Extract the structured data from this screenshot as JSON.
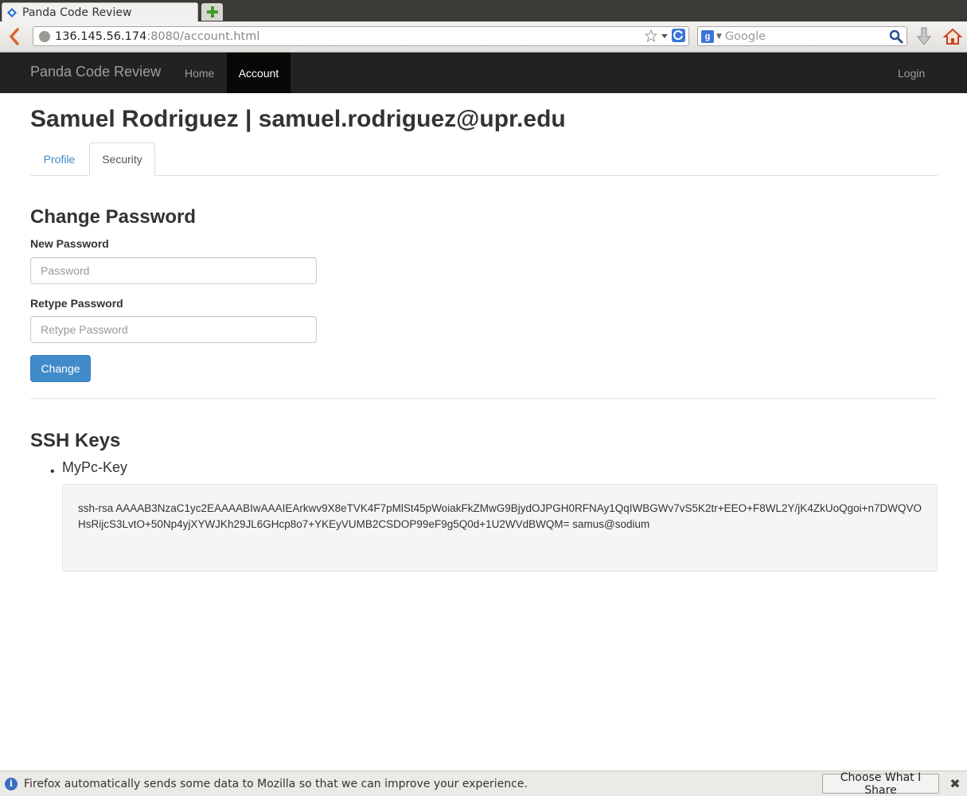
{
  "browser": {
    "tab_title": "Panda Code Review",
    "url_host": "136.145.56.174",
    "url_rest": ":8080/account.html",
    "search_engine": "Google",
    "search_engine_letter": "g",
    "accent_colors": {
      "reload": "#3a75d6",
      "download": "#8a8a8a",
      "home": "#c9442a",
      "new_tab": "#3f9b2d"
    }
  },
  "app_nav": {
    "brand": "Panda Code Review",
    "home": "Home",
    "account": "Account",
    "login": "Login"
  },
  "page": {
    "title": "Samuel Rodriguez | samuel.rodriguez@upr.edu",
    "tabs": [
      {
        "label": "Profile",
        "active": false
      },
      {
        "label": "Security",
        "active": true
      }
    ]
  },
  "change_password": {
    "heading": "Change Password",
    "new_label": "New Password",
    "new_placeholder": "Password",
    "retype_label": "Retype Password",
    "retype_placeholder": "Retype Password",
    "button": "Change"
  },
  "ssh_keys": {
    "heading": "SSH Keys",
    "keys": [
      {
        "name": "MyPc-Key",
        "value": "ssh-rsa AAAAB3NzaC1yc2EAAAABIwAAAIEArkwv9X8eTVK4F7pMlSt45pWoiakFkZMwG9BjydOJPGH0RFNAy1QqIWBGWv7vS5K2tr+EEO+F8WL2Y/jK4ZkUoQgoi+n7DWQVOHsRijcS3LvtO+50Np4yjXYWJKh29JL6GHcp8o7+YKEyVUMB2CSDOP99eF9g5Q0d+1U2WVdBWQM= samus@sodium"
      }
    ]
  },
  "notification": {
    "text": "Firefox automatically sends some data to Mozilla so that we can improve your experience.",
    "button": "Choose What I Share"
  }
}
